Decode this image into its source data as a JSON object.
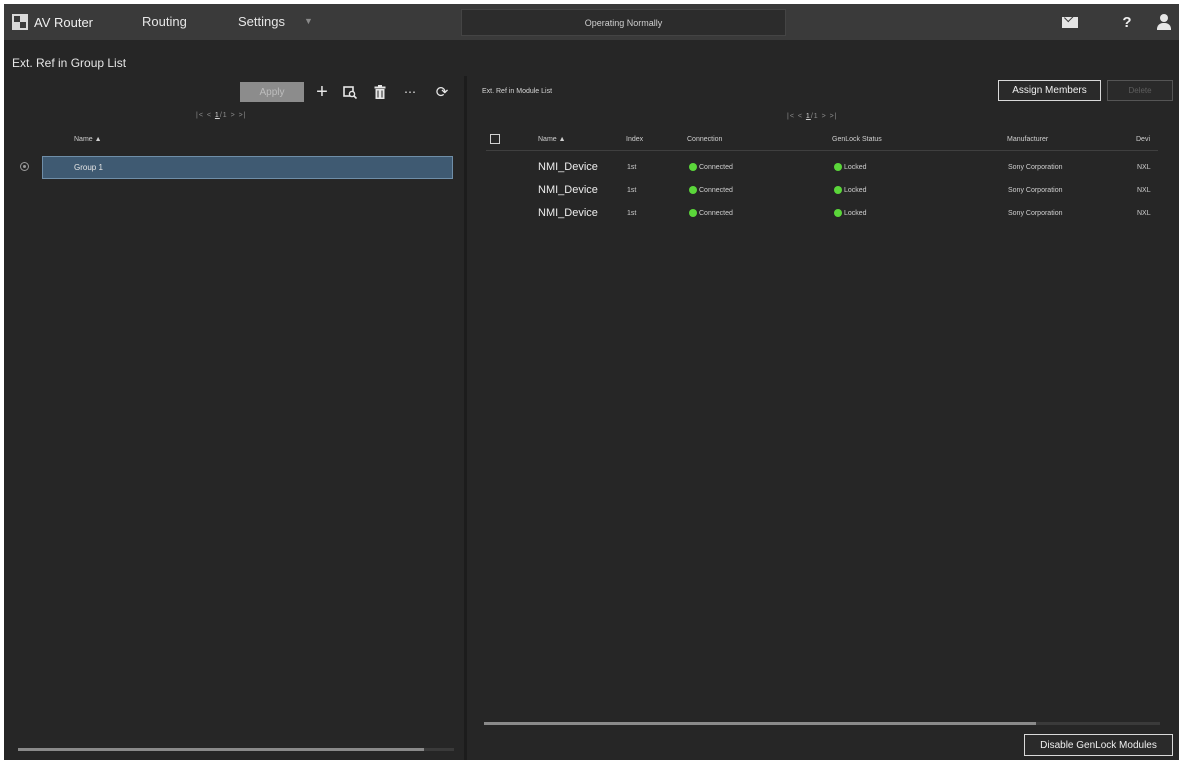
{
  "topbar": {
    "app_title": "AV Router",
    "nav": {
      "routing": "Routing",
      "settings": "Settings"
    },
    "status": "Operating Normally",
    "icons": {
      "mail": "mail-icon",
      "help": "help-icon",
      "user": "user-icon"
    },
    "help_glyph": "?"
  },
  "page_title": "Ext. Ref in Group List",
  "group_list": {
    "apply_label": "Apply",
    "pager": {
      "first": "|<",
      "prev": "<",
      "current": "1",
      "sep": "/",
      "total": "1",
      "next": ">",
      "last": ">|"
    },
    "column_name": "Name",
    "rows": [
      {
        "name": "Group 1"
      }
    ]
  },
  "module_list": {
    "title": "Ext. Ref in Module List",
    "assign_label": "Assign Members",
    "delete_label": "Delete",
    "pager": {
      "first": "|<",
      "prev": "<",
      "current": "1",
      "sep": "/",
      "total": "1",
      "next": ">",
      "last": ">|"
    },
    "columns": {
      "name": "Name",
      "index": "Index",
      "connection": "Connection",
      "genlock": "GenLock Status",
      "manufacturer": "Manufacturer",
      "device": "Devi"
    },
    "rows": [
      {
        "name": "NMI_Device",
        "index": "1st",
        "connection": "Connected",
        "genlock": "Locked",
        "manufacturer": "Sony Corporation",
        "device": "NXL"
      },
      {
        "name": "NMI_Device",
        "index": "1st",
        "connection": "Connected",
        "genlock": "Locked",
        "manufacturer": "Sony Corporation",
        "device": "NXL"
      },
      {
        "name": "NMI_Device",
        "index": "1st",
        "connection": "Connected",
        "genlock": "Locked",
        "manufacturer": "Sony Corporation",
        "device": "NXL"
      }
    ],
    "disable_label": "Disable GenLock Modules"
  },
  "colors": {
    "status_ok": "#5bd63a",
    "selected_row": "#3f5a72",
    "background": "#262626"
  }
}
